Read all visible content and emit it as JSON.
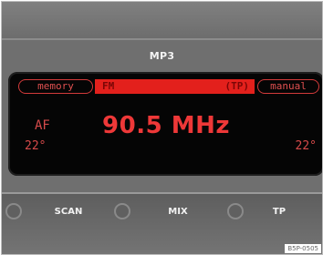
{
  "header": {
    "source_label": "MP3"
  },
  "display": {
    "memory_label": "memory",
    "band_label": "FM",
    "tp_label": "(TP)",
    "manual_label": "manual",
    "af_label": "AF",
    "frequency": "90.5 MHz",
    "temp_left": "22°",
    "temp_right": "22°"
  },
  "softkeys": [
    {
      "label": "SCAN"
    },
    {
      "label": "MIX"
    },
    {
      "label": "TP"
    }
  ],
  "figure_code": "B5P-0505",
  "colors": {
    "display_red": "#e3201c",
    "display_bg": "#050505",
    "panel_gray": "#6f6f6f"
  }
}
